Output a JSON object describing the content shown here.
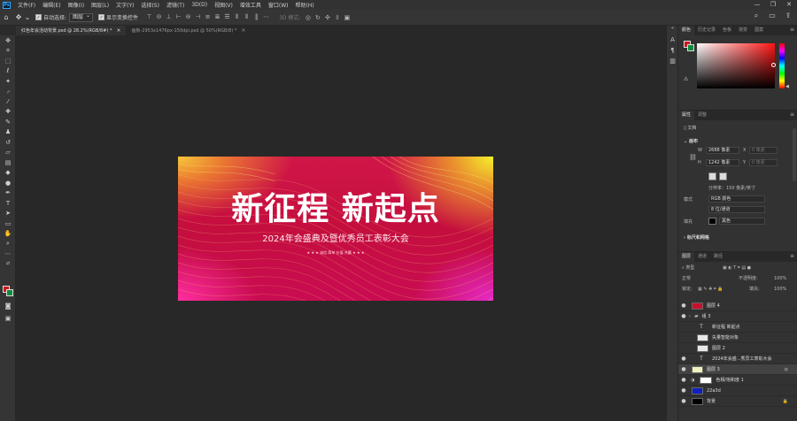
{
  "app": {
    "logo": "Ps"
  },
  "menu": [
    "文件(F)",
    "编辑(E)",
    "图像(I)",
    "图层(L)",
    "文字(Y)",
    "选择(S)",
    "滤镜(T)",
    "3D(D)",
    "视图(V)",
    "增效工具",
    "窗口(W)",
    "帮助(H)"
  ],
  "window_controls": [
    "—",
    "❐",
    "✕"
  ],
  "options": {
    "auto_select_label": "自动选择:",
    "auto_select_value": "图层",
    "show_transform_label": "显示变换控件",
    "mode_label": "3D 模式:"
  },
  "tabs": [
    {
      "label": "红色年会活动背景.psd @ 28.2%(RGB/8#) *",
      "close": "×"
    },
    {
      "label": "画板-2953x1476px-150dpi.psd @ 50%(RGB/8) *",
      "close": "×"
    }
  ],
  "artwork": {
    "title": "新征程 新起点",
    "subtitle": "2024年会盛典及暨优秀员工表彰大会",
    "tagline": "★ ★ ★ 诚信 简单 价值 共赢 ★ ★ ★"
  },
  "color_panel": {
    "tabs": [
      "颜色",
      "历史记录",
      "色板",
      "渐变",
      "图案"
    ],
    "fg_color": "#c8181c",
    "bg_color": "#0c8a3a"
  },
  "properties": {
    "tabs": [
      "属性",
      "调整"
    ],
    "doc_label": "文档",
    "canvas_section": "画布",
    "w_label": "W",
    "w_value": "2688 像素",
    "h_label": "H",
    "h_value": "1242 像素",
    "x_label": "X",
    "x_value": "0 像素",
    "y_label": "Y",
    "y_value": "0 像素",
    "resolution": "分辨率：150 像素/英寸",
    "mode_label": "模式",
    "mode_value": "RGB 颜色",
    "bit_value": "8 位/通道",
    "fill_label": "填充",
    "fill_value": "黑色",
    "rulers_section": "标尺和网格"
  },
  "layers": {
    "tabs": [
      "图层",
      "通道",
      "路径"
    ],
    "kind_label": "类型",
    "blend_mode": "正常",
    "opacity_label": "不透明度:",
    "opacity_value": "100%",
    "lock_label": "锁定:",
    "fill_label": "填充:",
    "fill_value": "100%",
    "items": [
      {
        "name": "图层 4",
        "thumb": "#c8102e",
        "visible": "●",
        "kind": ""
      },
      {
        "name": "组 3",
        "thumb": "#555555",
        "visible": "●",
        "kind": "folder"
      },
      {
        "name": "新征程 新起点",
        "thumb": "",
        "visible": "",
        "kind": "T"
      },
      {
        "name": "矢量智能对象",
        "thumb": "#e8e8e8",
        "visible": "",
        "kind": ""
      },
      {
        "name": "图层 2",
        "thumb": "#e8e8e8",
        "visible": "",
        "kind": ""
      },
      {
        "name": "2024年会盛...秀员工表彰大会",
        "thumb": "",
        "visible": "●",
        "kind": "T"
      },
      {
        "name": "图层 3",
        "thumb": "#f0f0c0",
        "visible": "●",
        "kind": ""
      },
      {
        "name": "色相/饱和度 1",
        "thumb": "#ffffff",
        "visible": "●",
        "kind": "adj"
      },
      {
        "name": "22a3d",
        "thumb": "#1020c0",
        "visible": "●",
        "kind": ""
      },
      {
        "name": "背景",
        "thumb": "#000000",
        "visible": "●",
        "kind": ""
      }
    ]
  }
}
